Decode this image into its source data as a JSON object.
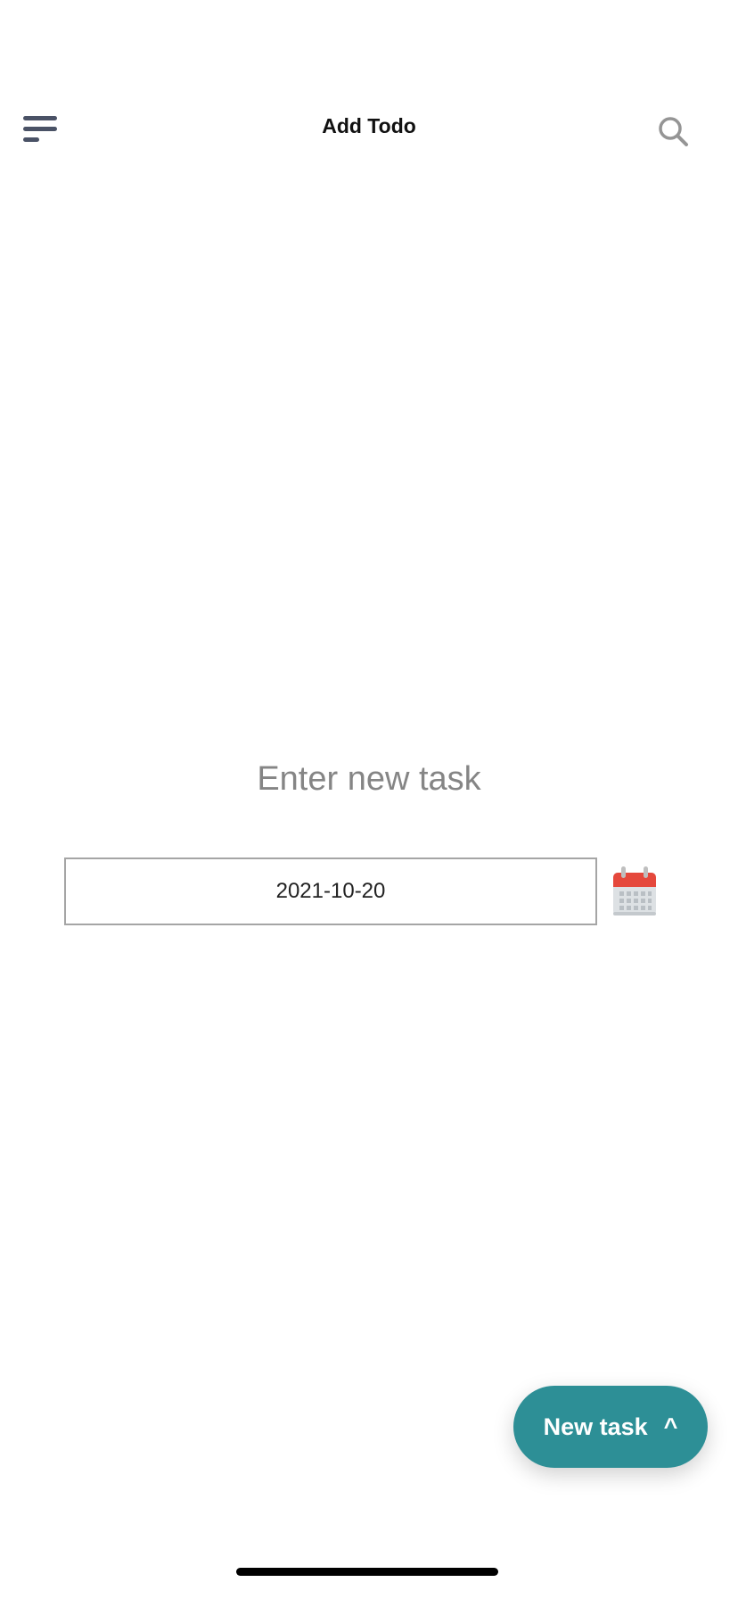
{
  "header": {
    "title": "Add Todo",
    "menu_icon": "menu-icon",
    "search_icon": "search-icon"
  },
  "form": {
    "prompt": "Enter new task",
    "date_value": "2021-10-20",
    "calendar_icon": "calendar-icon"
  },
  "fab": {
    "label": "New task",
    "chevron": "^",
    "color": "#2d8f96"
  }
}
